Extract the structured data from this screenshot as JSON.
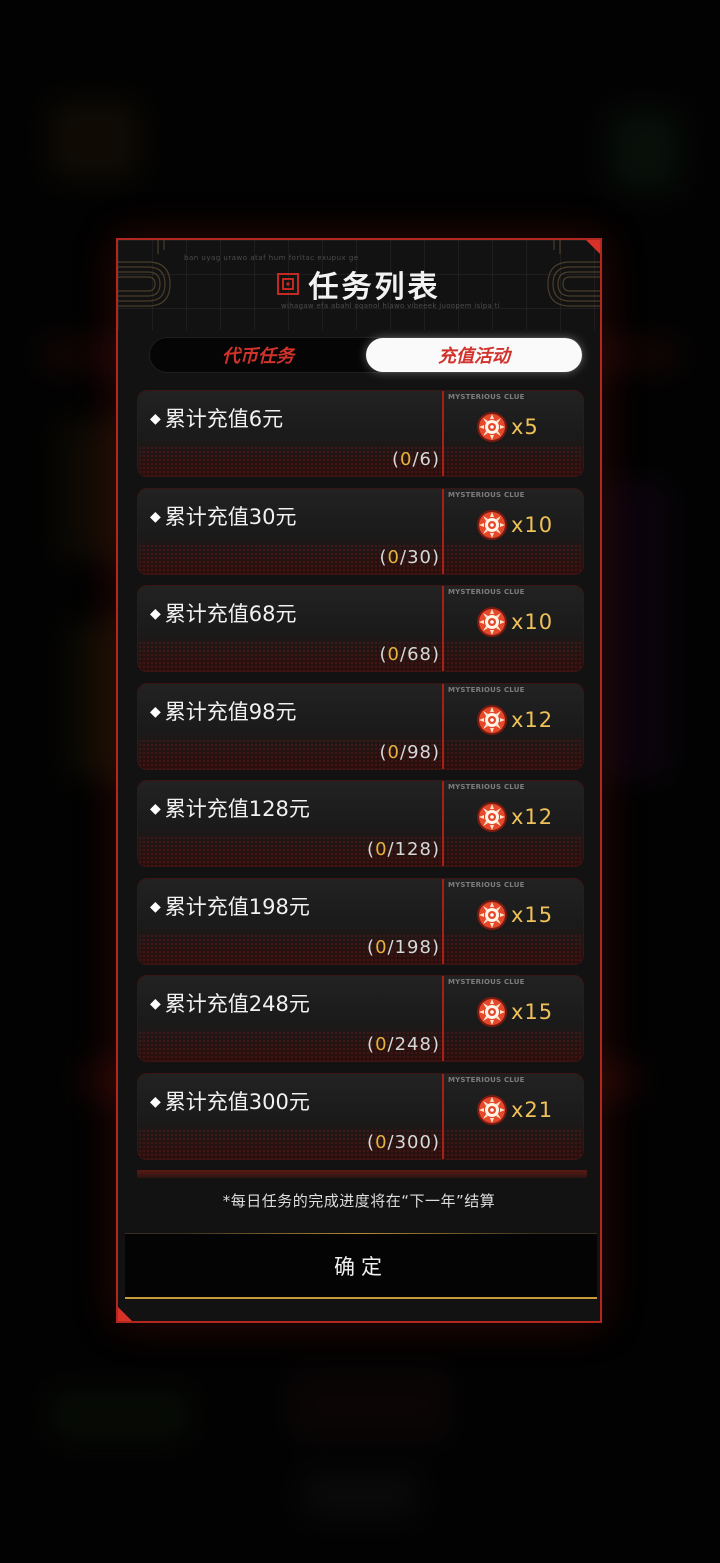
{
  "modal": {
    "title": "任务列表",
    "micro_text_top": "ban uyag urawo ataf hum forltac exupux ge",
    "micro_text_bottom": "wihagaw efa abahl oqanol hlawo vibeeek juoopem islpa ti",
    "tabs": [
      {
        "label": "代币任务",
        "active": false
      },
      {
        "label": "充值活动",
        "active": true
      }
    ],
    "reward_tag": "MYSTERIOUS CLUE",
    "tasks": [
      {
        "name": "累计充值6元",
        "progress_current": "0",
        "progress_total": "6",
        "reward": "x5"
      },
      {
        "name": "累计充值30元",
        "progress_current": "0",
        "progress_total": "30",
        "reward": "x10"
      },
      {
        "name": "累计充值68元",
        "progress_current": "0",
        "progress_total": "68",
        "reward": "x10"
      },
      {
        "name": "累计充值98元",
        "progress_current": "0",
        "progress_total": "98",
        "reward": "x12"
      },
      {
        "name": "累计充值128元",
        "progress_current": "0",
        "progress_total": "128",
        "reward": "x12"
      },
      {
        "name": "累计充值198元",
        "progress_current": "0",
        "progress_total": "198",
        "reward": "x15"
      },
      {
        "name": "累计充值248元",
        "progress_current": "0",
        "progress_total": "248",
        "reward": "x15"
      },
      {
        "name": "累计充值300元",
        "progress_current": "0",
        "progress_total": "300",
        "reward": "x21"
      }
    ],
    "note": "*每日任务的完成进度将在“下一年”结算",
    "confirm_label": "确定"
  },
  "colors": {
    "accent_red": "#d1322b",
    "progress_gold": "#e6b23d",
    "reward_gold": "#efc159",
    "border_red": "#b3281e"
  },
  "icons": {
    "title": "grid-emblem-icon",
    "task_bullet": "diamond-icon",
    "reward": "mysterious-clue-icon"
  }
}
